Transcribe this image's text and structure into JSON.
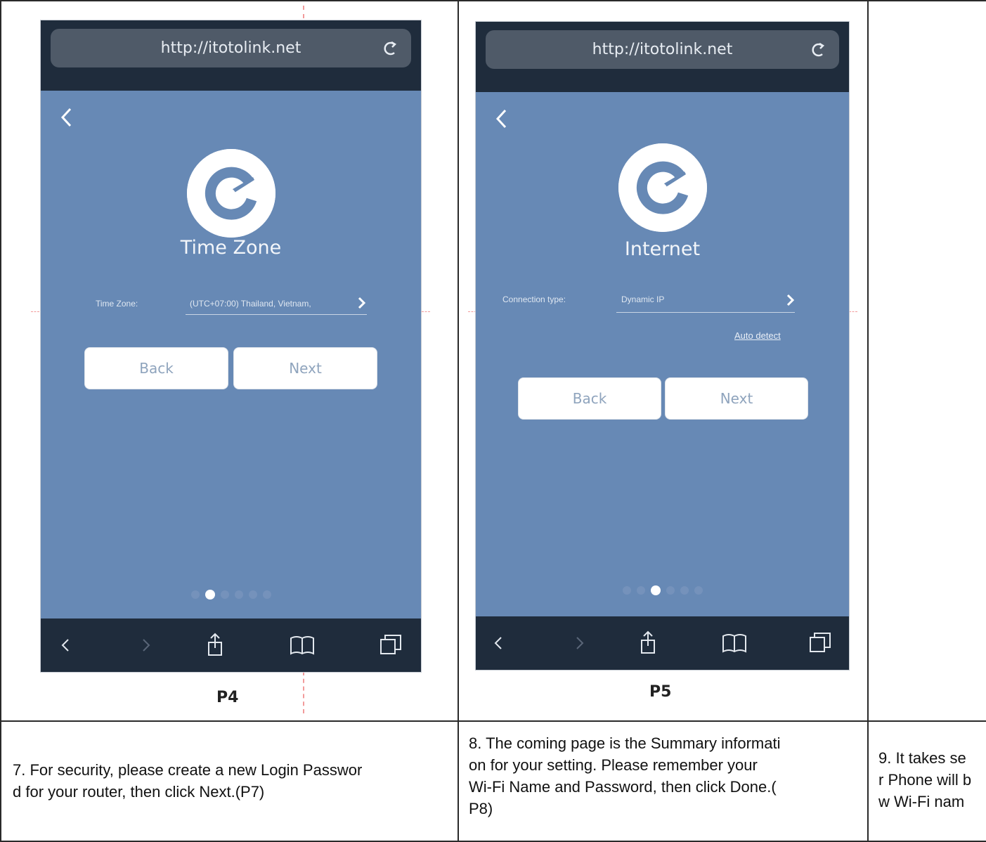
{
  "panels": [
    {
      "url": "http://itotolink.net",
      "title": "Time Zone",
      "field_label": "Time Zone:",
      "field_value": "(UTC+07:00) Thailand, Vietnam,",
      "back_label": "Back",
      "next_label": "Next",
      "active_dot": 1,
      "dot_count": 6,
      "caption": "P4"
    },
    {
      "url": "http://itotolink.net",
      "title": "Internet",
      "field_label": "Connection type:",
      "field_value": "Dynamic IP",
      "auto_detect_label": "Auto detect",
      "back_label": "Back",
      "next_label": "Next",
      "active_dot": 2,
      "dot_count": 6,
      "caption": "P5"
    }
  ],
  "steps": [
    {
      "text": "7. For security, please create a new Login Passwor d for your router, then click Next.(P7)"
    },
    {
      "text": "8. The coming page is the Summary informati on for your setting. Please remember your Wi-Fi Name and Password, then click Done.( P8)"
    },
    {
      "text": "9. It takes se r Phone will b w Wi-Fi nam"
    }
  ],
  "step_lines": [
    [
      "7. For security, please create a new Login Passwor",
      "d for your router, then click Next.(P7)"
    ],
    [
      "8. The coming page is the Summary informati",
      "on for your setting. Please remember your",
      "Wi-Fi Name and Password, then click Done.(",
      "P8)"
    ],
    [
      "9. It takes se",
      "r Phone will b",
      "w Wi-Fi nam"
    ]
  ],
  "colors": {
    "phone_bg": "#6789b5",
    "bar_bg": "#1f2c3c",
    "button_text": "#8fa4bd"
  }
}
